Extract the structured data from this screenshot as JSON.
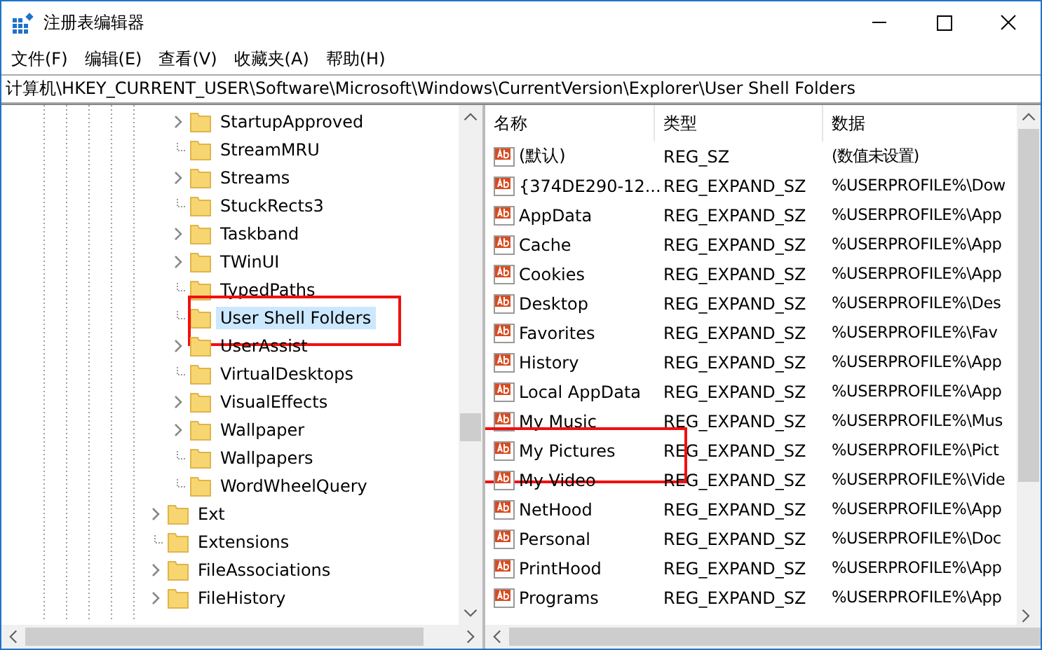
{
  "window": {
    "title": "注册表编辑器"
  },
  "menu": [
    "文件(F)",
    "编辑(E)",
    "查看(V)",
    "收藏夹(A)",
    "帮助(H)"
  ],
  "address": "计算机\\HKEY_CURRENT_USER\\Software\\Microsoft\\Windows\\CurrentVersion\\Explorer\\User Shell Folders",
  "tree": [
    {
      "kind": "offscreen-parent",
      "children": [
        {
          "label": "StartupApproved",
          "expandable": true,
          "selected": false,
          "annotated": false
        },
        {
          "label": "StreamMRU",
          "expandable": false,
          "selected": false,
          "annotated": false
        },
        {
          "label": "Streams",
          "expandable": true,
          "selected": false,
          "annotated": false
        },
        {
          "label": "StuckRects3",
          "expandable": false,
          "selected": false,
          "annotated": false
        },
        {
          "label": "Taskband",
          "expandable": true,
          "selected": false,
          "annotated": false
        },
        {
          "label": "TWinUI",
          "expandable": true,
          "selected": false,
          "annotated": false
        },
        {
          "label": "TypedPaths",
          "expandable": false,
          "selected": false,
          "annotated": false
        },
        {
          "label": "User Shell Folders",
          "expandable": false,
          "selected": true,
          "annotated": true
        },
        {
          "label": "UserAssist",
          "expandable": true,
          "selected": false,
          "annotated": false
        },
        {
          "label": "VirtualDesktops",
          "expandable": false,
          "selected": false,
          "annotated": false
        },
        {
          "label": "VisualEffects",
          "expandable": true,
          "selected": false,
          "annotated": false
        },
        {
          "label": "Wallpaper",
          "expandable": true,
          "selected": false,
          "annotated": false
        },
        {
          "label": "Wallpapers",
          "expandable": false,
          "selected": false,
          "annotated": false
        },
        {
          "label": "WordWheelQuery",
          "expandable": false,
          "selected": false,
          "annotated": false
        }
      ]
    },
    {
      "kind": "key",
      "label": "Ext",
      "expandable": true,
      "selected": false,
      "annotated": false
    },
    {
      "kind": "key",
      "label": "Extensions",
      "expandable": false,
      "selected": false,
      "annotated": false
    },
    {
      "kind": "key",
      "label": "FileAssociations",
      "expandable": true,
      "selected": false,
      "annotated": false
    },
    {
      "kind": "key",
      "label": "FileHistory",
      "expandable": true,
      "selected": false,
      "annotated": false
    }
  ],
  "table": {
    "columns": [
      "名称",
      "类型",
      "数据"
    ],
    "rows": [
      {
        "name": "(默认)",
        "type": "REG_SZ",
        "data": "(数值未设置)",
        "annotated": false
      },
      {
        "name": "{374DE290-12...",
        "type": "REG_EXPAND_SZ",
        "data": "%USERPROFILE%\\Dow",
        "annotated": false
      },
      {
        "name": "AppData",
        "type": "REG_EXPAND_SZ",
        "data": "%USERPROFILE%\\App",
        "annotated": false
      },
      {
        "name": "Cache",
        "type": "REG_EXPAND_SZ",
        "data": "%USERPROFILE%\\App",
        "annotated": false
      },
      {
        "name": "Cookies",
        "type": "REG_EXPAND_SZ",
        "data": "%USERPROFILE%\\App",
        "annotated": false
      },
      {
        "name": "Desktop",
        "type": "REG_EXPAND_SZ",
        "data": "%USERPROFILE%\\Des",
        "annotated": false
      },
      {
        "name": "Favorites",
        "type": "REG_EXPAND_SZ",
        "data": "%USERPROFILE%\\Fav",
        "annotated": false
      },
      {
        "name": "History",
        "type": "REG_EXPAND_SZ",
        "data": "%USERPROFILE%\\App",
        "annotated": false
      },
      {
        "name": "Local AppData",
        "type": "REG_EXPAND_SZ",
        "data": "%USERPROFILE%\\App",
        "annotated": false
      },
      {
        "name": "My Music",
        "type": "REG_EXPAND_SZ",
        "data": "%USERPROFILE%\\Mus",
        "annotated": false
      },
      {
        "name": "My Pictures",
        "type": "REG_EXPAND_SZ",
        "data": "%USERPROFILE%\\Pict",
        "annotated": true
      },
      {
        "name": "My Video",
        "type": "REG_EXPAND_SZ",
        "data": "%USERPROFILE%\\Vide",
        "annotated": false
      },
      {
        "name": "NetHood",
        "type": "REG_EXPAND_SZ",
        "data": "%USERPROFILE%\\App",
        "annotated": false
      },
      {
        "name": "Personal",
        "type": "REG_EXPAND_SZ",
        "data": "%USERPROFILE%\\Doc",
        "annotated": false
      },
      {
        "name": "PrintHood",
        "type": "REG_EXPAND_SZ",
        "data": "%USERPROFILE%\\App",
        "annotated": false
      },
      {
        "name": "Programs",
        "type": "REG_EXPAND_SZ",
        "data": "%USERPROFILE%\\App",
        "annotated": false
      }
    ]
  }
}
